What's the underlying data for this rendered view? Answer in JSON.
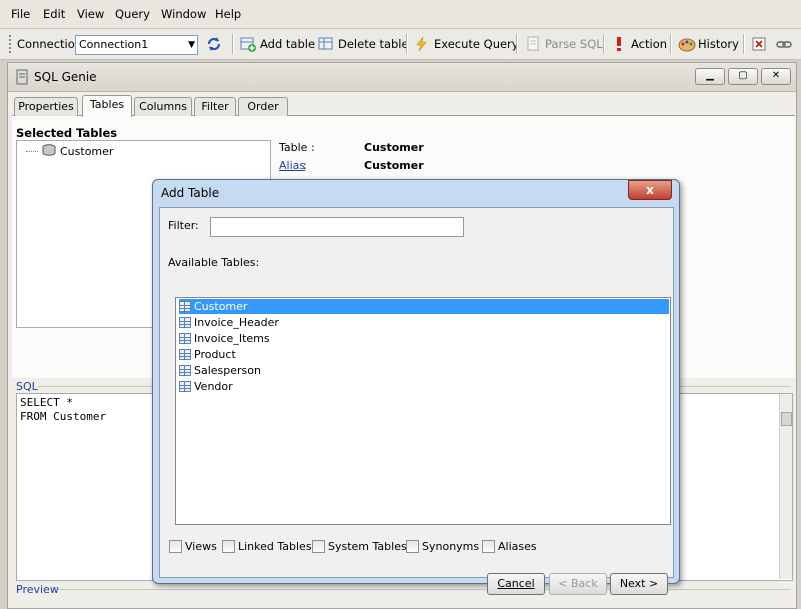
{
  "menu": [
    "File",
    "Edit",
    "View",
    "Query",
    "Window",
    "Help"
  ],
  "toolbar": {
    "connection_label": "Connection:",
    "connection_value": "Connection1",
    "add_table": "Add table",
    "delete_table": "Delete table",
    "execute_query": "Execute Query",
    "parse_sql": "Parse SQL",
    "action": "Action",
    "history": "History"
  },
  "window": {
    "title": "SQL Genie"
  },
  "tabs": [
    "Properties",
    "Tables",
    "Columns",
    "Filter",
    "Order"
  ],
  "selected_tables": {
    "heading": "Selected Tables",
    "items": [
      "Customer"
    ]
  },
  "properties": {
    "table_label": "Table :",
    "table_value": "Customer",
    "alias_label": "Alias",
    "alias_colon": ":",
    "alias_value": "Customer"
  },
  "sql": {
    "label": "SQL",
    "line1": "SELECT *",
    "line2": "FROM Customer"
  },
  "preview_label": "Preview",
  "dialog": {
    "title": "Add Table",
    "close": "x",
    "filter_label": "Filter:",
    "filter_value": "",
    "available_label": "Available Tables:",
    "tables": [
      "Customer",
      "Invoice_Header",
      "Invoice_Items",
      "Product",
      "Salesperson",
      "Vendor"
    ],
    "selected_index": 0,
    "options": [
      "Views",
      "Linked Tables",
      "System Tables",
      "Synonyms",
      "Aliases"
    ],
    "buttons": {
      "cancel": "Cancel",
      "back": "< Back",
      "next": "Next >"
    }
  }
}
